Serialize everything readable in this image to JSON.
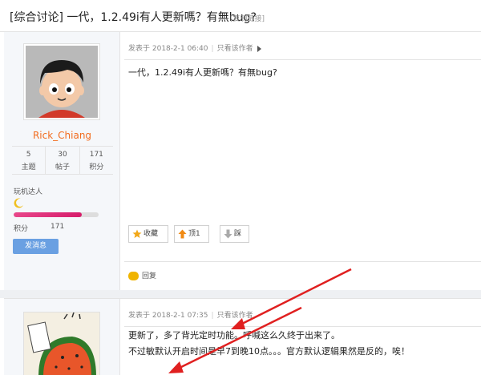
{
  "thread": {
    "title": "[综合讨论] 一代，1.2.49i有人更新嗎？有無bug?",
    "copy_link": "[复制链接]"
  },
  "post1": {
    "author": {
      "name": "Rick_Chiang",
      "stats": [
        {
          "value": "5",
          "label": "主题"
        },
        {
          "value": "30",
          "label": "帖子"
        },
        {
          "value": "171",
          "label": "积分"
        }
      ],
      "rank": "玩机达人",
      "credit_label": "积分",
      "credit_value": "171",
      "credit_progress": 0.8,
      "message_button": "发消息"
    },
    "meta": {
      "posted": "发表于 2018-2-1 06:40",
      "author_only": "只看该作者"
    },
    "content": "一代，1.2.49i有人更新嗎？有無bug?",
    "actions": {
      "favorite": "收藏",
      "up": "顶",
      "up_count": "1",
      "down": "踩"
    },
    "reply": "回复"
  },
  "post2": {
    "meta": {
      "posted": "发表于 2018-2-1 07:35",
      "author_only": "只看该作者"
    },
    "content_lines": [
      "更新了，多了背光定时功能。呼喊这么久终于出来了。",
      "不过敏默认开启时间是早7到晚10点。。。官方默认逻辑果然是反的，唉！"
    ]
  },
  "colors": {
    "username": "#f26c1e",
    "button_blue": "#6aa0e2",
    "credit_bar": "#d61c6a",
    "annotation_arrow": "#e02020"
  },
  "icons": [
    "star-icon",
    "up-arrow-icon",
    "down-arrow-icon",
    "reply-bubble-icon",
    "moon-icon",
    "triangle-right-icon"
  ]
}
